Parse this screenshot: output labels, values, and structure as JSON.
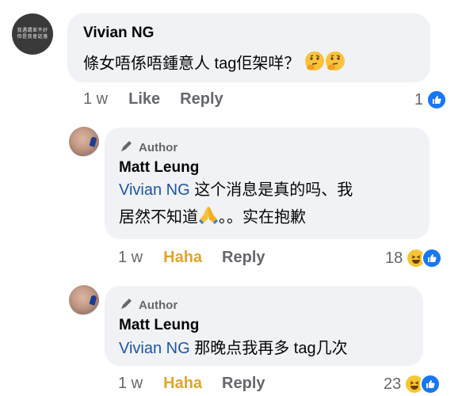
{
  "comments": [
    {
      "author": "Vivian NG",
      "avatar_text": [
        "我遇謂差不好",
        "但是我會話落"
      ],
      "text": "條女唔係唔鍾意人 tag佢架咩？",
      "time": "1 w",
      "actions": [
        "Like",
        "Reply"
      ],
      "reaction_count": "1"
    },
    {
      "author_badge": "Author",
      "author": "Matt Leung",
      "mention": "Vivian NG",
      "text_line1": " 这个消息是真的吗、我",
      "text_line2": "居然不知道",
      "text_line2_end": "。。实在抱歉",
      "time": "1 w",
      "actions": [
        "Haha",
        "Reply"
      ],
      "reaction_count": "18"
    },
    {
      "author_badge": "Author",
      "author": "Matt Leung",
      "mention": "Vivian NG",
      "text": " 那晚点我再多 tag几次",
      "time": "1 w",
      "actions": [
        "Haha",
        "Reply"
      ],
      "reaction_count": "23"
    }
  ],
  "colors": {
    "mention": "#1d55a6",
    "haha": "#e0a52d",
    "like": "#1877f2",
    "meta": "#65676b",
    "bubble": "#f0f2f5"
  },
  "icons": [
    "pen-icon",
    "thinking-face-emoji",
    "praying-hands-emoji",
    "like-reaction-icon",
    "haha-reaction-icon"
  ]
}
